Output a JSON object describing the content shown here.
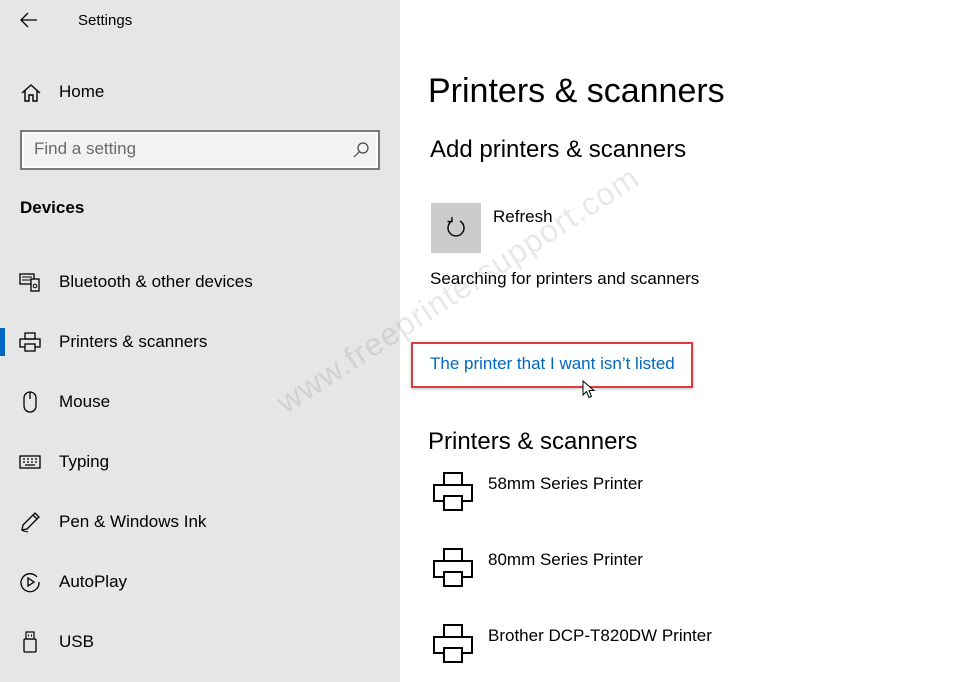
{
  "window": {
    "title": "Settings",
    "back_icon": "back-arrow-icon"
  },
  "sidebar": {
    "home_label": "Home",
    "search": {
      "placeholder": "Find a setting",
      "value": ""
    },
    "section_title": "Devices",
    "active_color": "#0067c0",
    "items": [
      {
        "label": "Bluetooth & other devices",
        "icon": "bluetooth-devices-icon",
        "active": false
      },
      {
        "label": "Printers & scanners",
        "icon": "printer-icon",
        "active": true
      },
      {
        "label": "Mouse",
        "icon": "mouse-icon",
        "active": false
      },
      {
        "label": "Typing",
        "icon": "keyboard-icon",
        "active": false
      },
      {
        "label": "Pen & Windows Ink",
        "icon": "pen-icon",
        "active": false
      },
      {
        "label": "AutoPlay",
        "icon": "autoplay-icon",
        "active": false
      },
      {
        "label": "USB",
        "icon": "usb-icon",
        "active": false
      }
    ]
  },
  "main": {
    "page_title": "Printers & scanners",
    "add_section_title": "Add printers & scanners",
    "refresh_label": "Refresh",
    "searching_text": "Searching for printers and scanners",
    "not_listed_link": "The printer that I want isn’t listed",
    "link_color": "#0067c0",
    "highlight_color": "#e0393e",
    "list_section_title": "Printers & scanners",
    "printers": [
      {
        "name": "58mm Series Printer"
      },
      {
        "name": "80mm Series Printer"
      },
      {
        "name": "Brother DCP-T820DW Printer"
      }
    ]
  },
  "watermark": "www.freeprintersupport.com"
}
